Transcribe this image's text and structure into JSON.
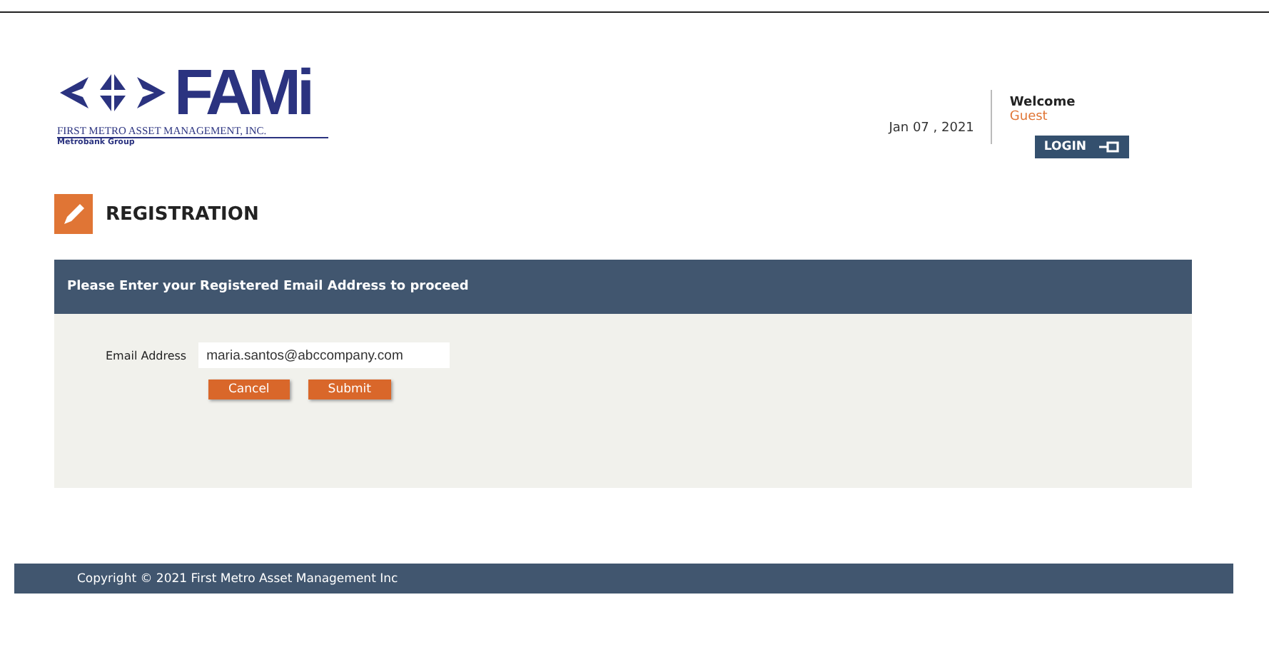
{
  "logo": {
    "wordmark": "FAMi",
    "company": "FIRST METRO ASSET MANAGEMENT, INC.",
    "group": "Metrobank Group"
  },
  "header": {
    "date": "Jan 07 , 2021",
    "welcome": "Welcome",
    "user": "Guest",
    "login_button": "LOGIN"
  },
  "page_title": "REGISTRATION",
  "panel": {
    "heading": "Please Enter your Registered Email Address to proceed",
    "email_label": "Email Address",
    "email_value": "maria.santos@abccompany.com",
    "buttons": [
      "Cancel",
      "Submit"
    ]
  },
  "footer": "Copyright © 2021 First Metro Asset Management Inc"
}
